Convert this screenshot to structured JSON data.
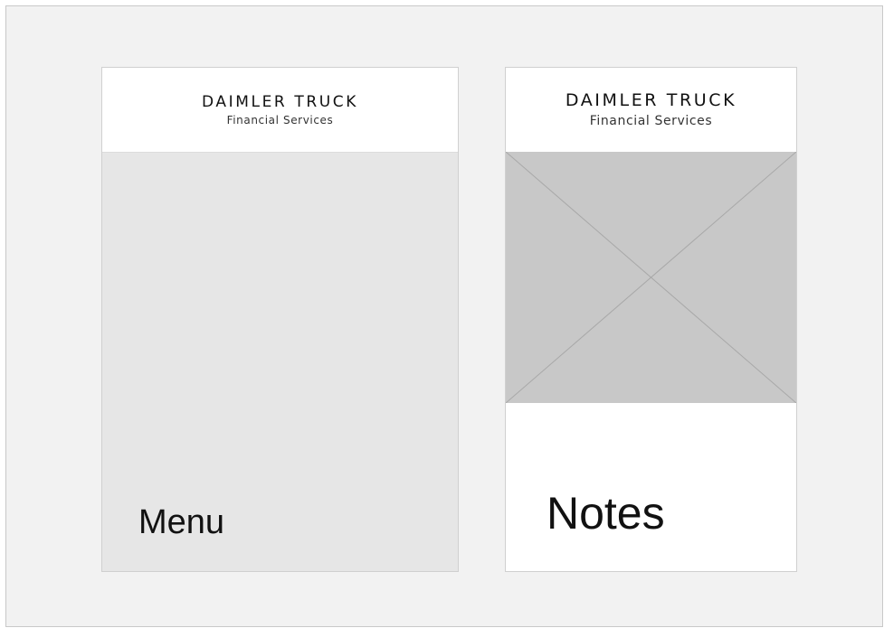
{
  "panels": [
    {
      "brand": {
        "title": "DAIMLER TRUCK",
        "subtitle": "Financial Services"
      },
      "label": "Menu"
    },
    {
      "brand": {
        "title": "DAIMLER TRUCK",
        "subtitle": "Financial Services"
      },
      "image": "image-placeholder-icon",
      "label": "Notes"
    }
  ],
  "colors": {
    "canvas": "#f2f2f2",
    "menu_area": "#e6e6e6",
    "image_placeholder": "#c8c8c8",
    "text": "#111111"
  }
}
